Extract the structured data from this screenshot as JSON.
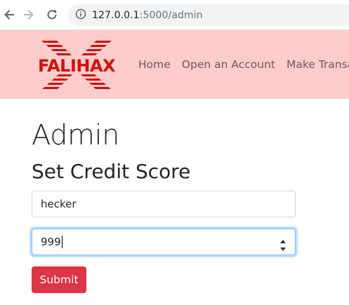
{
  "browser": {
    "url_host": "127.0.0.1",
    "url_rest": ":5000/admin",
    "icons": {
      "back": "arrow-left-icon",
      "forward": "arrow-right-icon",
      "reload": "reload-icon",
      "info": "info-icon"
    }
  },
  "header": {
    "brand": "FALIHAX",
    "nav": [
      "Home",
      "Open an Account",
      "Make Transaction"
    ]
  },
  "main": {
    "page_title": "Admin",
    "section_title": "Set Credit Score",
    "username_value": "hecker",
    "score_value": "999",
    "submit_label": "Submit"
  },
  "colors": {
    "header_bg": "#ffcccc",
    "brand_red": "#cc1111",
    "submit_bg": "#dc3545",
    "focus_border": "#80bdff"
  }
}
